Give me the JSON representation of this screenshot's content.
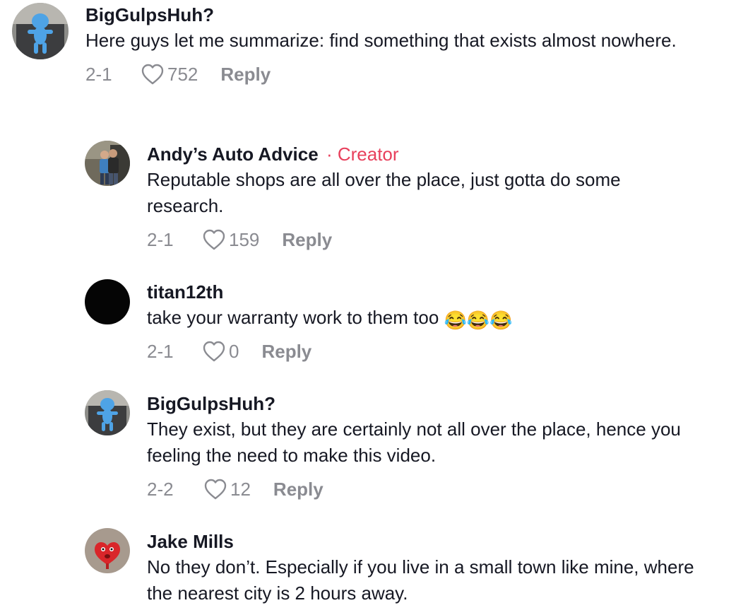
{
  "comments": [
    {
      "username": "BigGulpsHuh?",
      "text": "Here guys let me summarize: find something that exists almost nowhere.",
      "date": "2-1",
      "likes": "752",
      "reply_label": "Reply",
      "avatar": "blue-figurine-avatar"
    },
    {
      "username": "Andy’s Auto Advice",
      "badge_sep": "·",
      "badge": "Creator",
      "text": "Reputable shops are all over the place, just gotta do some research.",
      "date": "2-1",
      "likes": "159",
      "reply_label": "Reply",
      "avatar": "couple-photo-avatar"
    },
    {
      "username": "titan12th",
      "text": "take your warranty work to them too",
      "emoji": "😂😂😂",
      "date": "2-1",
      "likes": "0",
      "reply_label": "Reply",
      "avatar": "black-avatar"
    },
    {
      "username": "BigGulpsHuh?",
      "text": "They exist, but they are certainly not all over the place, hence you feeling the need to make this video.",
      "date": "2-2",
      "likes": "12",
      "reply_label": "Reply",
      "avatar": "blue-figurine-avatar"
    },
    {
      "username": "Jake Mills",
      "text": "No they don’t. Especially if you live in a small town like mine, where the nearest city is 2 hours away.",
      "avatar": "red-heart-face-avatar"
    }
  ],
  "colors": {
    "creator_accent": "#e8405c",
    "meta_gray": "#8a8b91",
    "text": "#161823"
  }
}
